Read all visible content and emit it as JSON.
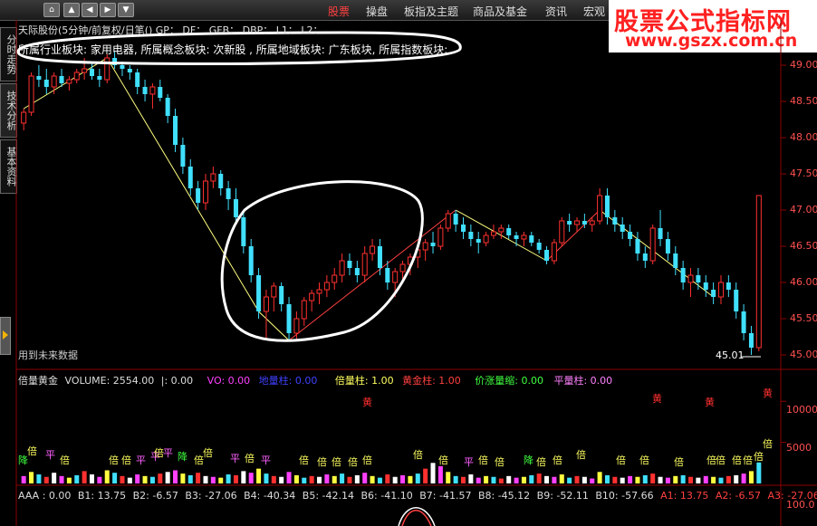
{
  "menu": {
    "items": [
      "股票",
      "操盘",
      "板指及主题",
      "商品及基金",
      "资讯",
      "宏观"
    ],
    "active_index": 0
  },
  "watermark": {
    "line1": "股票公式指标网",
    "line2": "www.gszx.com.cn"
  },
  "left_tabs": [
    "分时走势",
    "技术分析",
    "基本资料"
  ],
  "chart_title": {
    "text": "天际股份(5分钟/前复权/日笔()  GP：  DF：  GFB：  DBP：  L1：  L2："
  },
  "sector_info": "所属行业板块: 家用电器, 所属概念板块: 次新股 , 所属地域板块: 广东板块, 所属指数板块:",
  "future_label": "用到未来数据",
  "last_price_label": "45.01",
  "price_axis": [
    "49.00",
    "48.50",
    "48.00",
    "47.50",
    "47.00",
    "46.50",
    "46.00",
    "45.50",
    "45.00"
  ],
  "volume_axis": [
    "10000",
    "5000"
  ],
  "macd_axis": [
    "100.0"
  ],
  "sub1": {
    "name": "倍量黄金",
    "volume": "VOLUME: 2554.00",
    "sep": "|: 0.00",
    "vo": "VO: 0.00",
    "dl": "地量柱: 0.00",
    "bl": "倍量柱: 1.00",
    "hj": "黄金柱: 1.00",
    "jz": "价涨量缩: 0.00",
    "pl": "平量柱: 0.00"
  },
  "sub2": {
    "name": "AAA",
    "items": [
      ": 0.00",
      "B1: 13.75",
      "B2: -6.57",
      "B3: -27.06",
      "B4: -40.34",
      "B5: -42.14",
      "B6: -41.10",
      "B7: -41.57",
      "B8: -45.12",
      "B9: -52.11",
      "B10: -57.66",
      "A1: 13.75",
      "A2: -6.57",
      "A3: -27.06"
    ]
  },
  "signal_labels": {
    "bei": "倍",
    "ping": "平",
    "jiang": "降",
    "huang": "黄"
  },
  "chart_data": {
    "type": "candlestick",
    "ylim": [
      45.0,
      49.2
    ],
    "ticks": [
      49.0,
      48.5,
      48.0,
      47.5,
      47.0,
      46.5,
      46.0,
      45.5,
      45.0
    ],
    "candles": [
      [
        48.2,
        48.4,
        48.1,
        48.35
      ],
      [
        48.35,
        48.9,
        48.3,
        48.85
      ],
      [
        48.85,
        49.0,
        48.7,
        48.8
      ],
      [
        48.8,
        48.95,
        48.6,
        48.7
      ],
      [
        48.7,
        48.9,
        48.6,
        48.85
      ],
      [
        48.85,
        48.95,
        48.7,
        48.75
      ],
      [
        48.75,
        48.85,
        48.65,
        48.8
      ],
      [
        48.8,
        48.95,
        48.75,
        48.9
      ],
      [
        48.9,
        49.1,
        48.8,
        48.95
      ],
      [
        48.95,
        49.05,
        48.8,
        48.85
      ],
      [
        48.85,
        48.95,
        48.7,
        48.8
      ],
      [
        48.8,
        49.15,
        48.75,
        49.1
      ],
      [
        49.1,
        49.2,
        48.95,
        49.0
      ],
      [
        49.0,
        49.05,
        48.85,
        48.95
      ],
      [
        48.95,
        49.0,
        48.8,
        48.9
      ],
      [
        48.9,
        48.95,
        48.6,
        48.7
      ],
      [
        48.7,
        48.8,
        48.5,
        48.6
      ],
      [
        48.6,
        48.75,
        48.4,
        48.7
      ],
      [
        48.7,
        48.8,
        48.5,
        48.55
      ],
      [
        48.55,
        48.6,
        48.2,
        48.3
      ],
      [
        48.3,
        48.4,
        47.8,
        47.9
      ],
      [
        47.9,
        48.0,
        47.5,
        47.6
      ],
      [
        47.6,
        47.7,
        47.2,
        47.3
      ],
      [
        47.3,
        47.4,
        47.0,
        47.1
      ],
      [
        47.1,
        47.5,
        47.0,
        47.4
      ],
      [
        47.4,
        47.6,
        47.3,
        47.5
      ],
      [
        47.5,
        47.55,
        47.2,
        47.3
      ],
      [
        47.3,
        47.4,
        47.0,
        47.15
      ],
      [
        47.15,
        47.3,
        46.8,
        46.9
      ],
      [
        46.9,
        47.0,
        46.4,
        46.5
      ],
      [
        46.5,
        46.6,
        46.0,
        46.1
      ],
      [
        46.1,
        46.2,
        45.5,
        45.6
      ],
      [
        45.6,
        45.9,
        45.2,
        45.8
      ],
      [
        45.8,
        46.0,
        45.6,
        45.95
      ],
      [
        45.95,
        46.0,
        45.6,
        45.7
      ],
      [
        45.7,
        45.8,
        45.2,
        45.3
      ],
      [
        45.3,
        45.6,
        45.2,
        45.5
      ],
      [
        45.5,
        45.8,
        45.4,
        45.75
      ],
      [
        45.75,
        45.9,
        45.6,
        45.85
      ],
      [
        45.85,
        46.0,
        45.7,
        45.9
      ],
      [
        45.9,
        46.1,
        45.8,
        46.0
      ],
      [
        46.0,
        46.2,
        45.9,
        46.1
      ],
      [
        46.1,
        46.4,
        46.0,
        46.3
      ],
      [
        46.3,
        46.4,
        46.1,
        46.2
      ],
      [
        46.2,
        46.3,
        46.0,
        46.1
      ],
      [
        46.1,
        46.5,
        46.0,
        46.4
      ],
      [
        46.4,
        46.6,
        46.3,
        46.5
      ],
      [
        46.5,
        46.6,
        46.1,
        46.2
      ],
      [
        46.2,
        46.3,
        45.9,
        46.0
      ],
      [
        46.0,
        46.2,
        45.8,
        46.15
      ],
      [
        46.15,
        46.3,
        46.0,
        46.25
      ],
      [
        46.25,
        46.4,
        46.1,
        46.35
      ],
      [
        46.35,
        46.5,
        46.2,
        46.45
      ],
      [
        46.45,
        46.6,
        46.3,
        46.55
      ],
      [
        46.55,
        46.7,
        46.4,
        46.5
      ],
      [
        46.5,
        46.8,
        46.45,
        46.75
      ],
      [
        46.75,
        47.0,
        46.7,
        46.95
      ],
      [
        46.95,
        47.0,
        46.7,
        46.8
      ],
      [
        46.8,
        46.9,
        46.6,
        46.7
      ],
      [
        46.7,
        46.8,
        46.5,
        46.6
      ],
      [
        46.6,
        46.7,
        46.4,
        46.55
      ],
      [
        46.55,
        46.7,
        46.5,
        46.65
      ],
      [
        46.65,
        46.8,
        46.6,
        46.7
      ],
      [
        46.7,
        46.8,
        46.6,
        46.75
      ],
      [
        46.75,
        46.8,
        46.6,
        46.65
      ],
      [
        46.65,
        46.7,
        46.5,
        46.6
      ],
      [
        46.6,
        46.7,
        46.5,
        46.65
      ],
      [
        46.65,
        46.7,
        46.5,
        46.55
      ],
      [
        46.55,
        46.6,
        46.4,
        46.45
      ],
      [
        46.45,
        46.5,
        46.25,
        46.3
      ],
      [
        46.3,
        46.6,
        46.25,
        46.55
      ],
      [
        46.55,
        46.9,
        46.5,
        46.85
      ],
      [
        46.85,
        46.95,
        46.7,
        46.8
      ],
      [
        46.8,
        46.9,
        46.7,
        46.85
      ],
      [
        46.85,
        46.95,
        46.75,
        46.8
      ],
      [
        46.8,
        46.9,
        46.7,
        46.85
      ],
      [
        46.85,
        47.3,
        46.8,
        47.2
      ],
      [
        47.2,
        47.3,
        46.8,
        46.9
      ],
      [
        46.9,
        47.0,
        46.7,
        46.8
      ],
      [
        46.8,
        46.9,
        46.6,
        46.7
      ],
      [
        46.7,
        46.8,
        46.5,
        46.6
      ],
      [
        46.6,
        46.7,
        46.3,
        46.4
      ],
      [
        46.4,
        46.5,
        46.2,
        46.3
      ],
      [
        46.3,
        46.8,
        46.25,
        46.75
      ],
      [
        46.75,
        47.0,
        46.5,
        46.6
      ],
      [
        46.6,
        46.7,
        46.3,
        46.4
      ],
      [
        46.4,
        46.5,
        46.1,
        46.2
      ],
      [
        46.2,
        46.3,
        45.9,
        46.0
      ],
      [
        46.0,
        46.2,
        45.8,
        46.1
      ],
      [
        46.1,
        46.2,
        45.9,
        46.0
      ],
      [
        46.0,
        46.1,
        45.8,
        45.9
      ],
      [
        45.9,
        46.0,
        45.7,
        45.8
      ],
      [
        45.8,
        46.1,
        45.7,
        46.0
      ],
      [
        46.0,
        46.1,
        45.8,
        45.9
      ],
      [
        45.9,
        46.0,
        45.5,
        45.6
      ],
      [
        45.6,
        45.7,
        45.2,
        45.3
      ],
      [
        45.3,
        45.4,
        45.0,
        45.1
      ],
      [
        45.1,
        47.2,
        45.05,
        47.2
      ]
    ],
    "trendlines": [
      {
        "color": "#ffff80",
        "points": [
          [
            0,
            48.4
          ],
          [
            11,
            49.1
          ],
          [
            31,
            45.6
          ],
          [
            35,
            45.2
          ]
        ]
      },
      {
        "color": "#ff4040",
        "points": [
          [
            35,
            45.2
          ],
          [
            57,
            47.0
          ]
        ]
      },
      {
        "color": "#ffff80",
        "points": [
          [
            57,
            47.0
          ],
          [
            69,
            46.3
          ]
        ]
      },
      {
        "color": "#ff4040",
        "points": [
          [
            69,
            46.3
          ],
          [
            76,
            47.0
          ]
        ]
      },
      {
        "color": "#ffff80",
        "points": [
          [
            76,
            47.0
          ],
          [
            91,
            45.8
          ]
        ]
      }
    ],
    "volume_ylim": [
      0,
      13000
    ],
    "volume_ticks": [
      10000,
      5000
    ],
    "volumes": [
      900,
      1400,
      1100,
      800,
      1300,
      900,
      700,
      1000,
      1500,
      1100,
      800,
      1600,
      1300,
      900,
      700,
      1100,
      900,
      800,
      1200,
      1400,
      1600,
      1200,
      1000,
      1300,
      900,
      800,
      700,
      1100,
      1000,
      1500,
      1300,
      1800,
      1200,
      900,
      800,
      1400,
      1000,
      700,
      900,
      800,
      1100,
      900,
      1200,
      800,
      1000,
      1300,
      900,
      700,
      1100,
      800,
      1000,
      900,
      1200,
      1800,
      2500,
      2100,
      1400,
      900,
      800,
      1100,
      700,
      900,
      800,
      600,
      900,
      700,
      800,
      1000,
      1200,
      900,
      800,
      1100,
      700,
      900,
      800,
      600,
      1400,
      1000,
      800,
      700,
      900,
      800,
      1000,
      1200,
      800,
      700,
      900,
      1000,
      800,
      700,
      900,
      800,
      700,
      900,
      1000,
      1200,
      1500,
      2554
    ]
  }
}
